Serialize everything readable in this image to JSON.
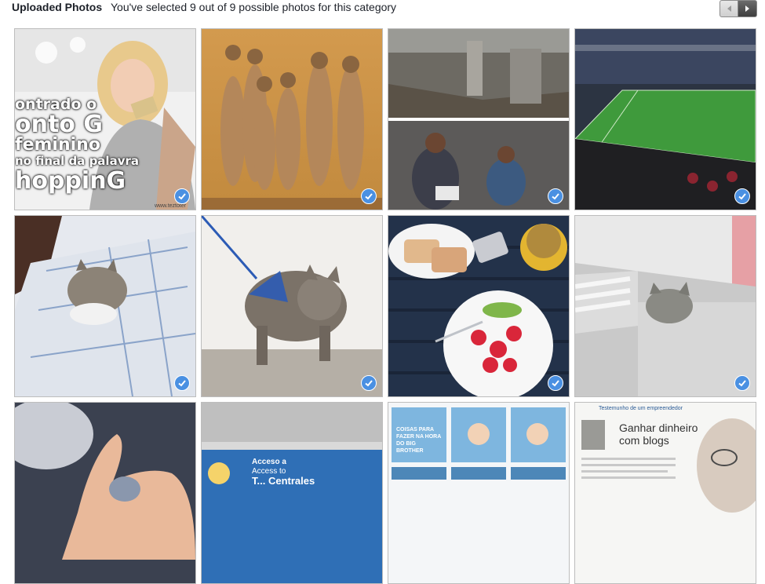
{
  "header": {
    "title": "Uploaded Photos",
    "status": "You've selected 9 out of 9 possible photos for this category"
  },
  "pager": {
    "prev_icon": "chevron-left-icon",
    "next_icon": "chevron-right-icon"
  },
  "accent_color": "#4a90e2",
  "photos": [
    {
      "name": "woman-shopping-photo",
      "selected": true,
      "caption_lines": [
        "ontrado o",
        "onto G",
        "feminino",
        "no final da palavra",
        "hoppinG"
      ],
      "watermark": "www.teztoter"
    },
    {
      "name": "meerkats-photo",
      "selected": true
    },
    {
      "name": "classroom-collage-photo",
      "selected": true
    },
    {
      "name": "stadium-photo",
      "selected": true
    },
    {
      "name": "cat-in-bed-photo",
      "selected": true
    },
    {
      "name": "cat-on-leash-photo",
      "selected": true
    },
    {
      "name": "breakfast-plate-photo",
      "selected": true
    },
    {
      "name": "cat-in-sink-photo",
      "selected": true
    },
    {
      "name": "hand-photo",
      "selected": false
    },
    {
      "name": "tunnel-sign-photo",
      "selected": false,
      "sign_text": [
        "Acceso a",
        "Access to",
        "T... Centrales"
      ]
    },
    {
      "name": "comic-infographic-photo",
      "selected": false,
      "panels": [
        "COISAS PARA FAZER NA HORA DO BIG BROTHER"
      ]
    },
    {
      "name": "magazine-article-photo",
      "selected": false,
      "heading": "Testemunho de um empreendedor",
      "title_lines": [
        "Ganhar dinheiro",
        "com blogs"
      ]
    }
  ]
}
